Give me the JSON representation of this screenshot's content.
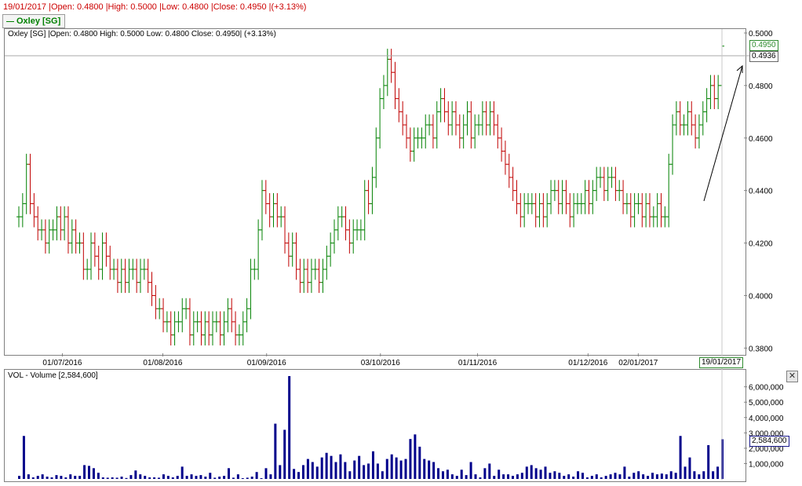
{
  "info_bar": {
    "text": "19/01/2017 |Open: 0.4800 |High: 0.5000 |Low: 0.4800 |Close: 0.4950 |(+3.13%)"
  },
  "legend": {
    "label": "Oxley [SG]",
    "color": "#008000"
  },
  "price_panel": {
    "header": "Oxley [SG] |Open: 0.4800   High: 0.5000   Low: 0.4800   Close: 0.4950| (+3.13%)",
    "close_badge": "0.4950",
    "crosshair_badge": "0.4936",
    "cursor_date_badge": "19/01/2017"
  },
  "volume_panel": {
    "header": "VOL - Volume [2,584,600]",
    "value_badge": "2,584,600",
    "close_icon": "close-icon"
  },
  "colors": {
    "up": "#008000",
    "down": "#c00000",
    "volume": "#00008b",
    "crosshair": "#a0a0a0"
  },
  "chart_data": [
    {
      "type": "ohlc",
      "title": "Oxley [SG]",
      "x_tick_labels": [
        "01/07/2016",
        "01/08/2016",
        "01/09/2016",
        "03/10/2016",
        "01/11/2016",
        "01/12/2016",
        "02/01/2017"
      ],
      "y_tick_labels": [
        "0.3800",
        "0.4000",
        "0.4200",
        "0.4400",
        "0.4600",
        "0.4800",
        "0.5000"
      ],
      "ylim": [
        0.378,
        0.5015
      ],
      "grid": false,
      "series": [
        {
          "name": "Oxley [SG]",
          "close": [
            0.43,
            0.435,
            0.45,
            0.435,
            0.43,
            0.425,
            0.425,
            0.42,
            0.425,
            0.425,
            0.43,
            0.425,
            0.43,
            0.42,
            0.425,
            0.42,
            0.42,
            0.41,
            0.41,
            0.42,
            0.415,
            0.41,
            0.42,
            0.415,
            0.41,
            0.41,
            0.405,
            0.41,
            0.405,
            0.41,
            0.41,
            0.405,
            0.41,
            0.41,
            0.405,
            0.4,
            0.395,
            0.395,
            0.39,
            0.39,
            0.385,
            0.39,
            0.39,
            0.395,
            0.395,
            0.385,
            0.39,
            0.39,
            0.385,
            0.39,
            0.385,
            0.39,
            0.39,
            0.385,
            0.39,
            0.395,
            0.39,
            0.385,
            0.385,
            0.39,
            0.395,
            0.41,
            0.41,
            0.425,
            0.44,
            0.435,
            0.43,
            0.435,
            0.43,
            0.43,
            0.42,
            0.415,
            0.42,
            0.41,
            0.405,
            0.41,
            0.405,
            0.41,
            0.41,
            0.405,
            0.41,
            0.415,
            0.42,
            0.425,
            0.43,
            0.43,
            0.425,
            0.42,
            0.425,
            0.425,
            0.425,
            0.44,
            0.435,
            0.445,
            0.46,
            0.475,
            0.48,
            0.49,
            0.485,
            0.475,
            0.47,
            0.465,
            0.46,
            0.455,
            0.46,
            0.46,
            0.46,
            0.465,
            0.465,
            0.46,
            0.47,
            0.475,
            0.47,
            0.465,
            0.47,
            0.465,
            0.46,
            0.465,
            0.47,
            0.46,
            0.465,
            0.465,
            0.47,
            0.465,
            0.47,
            0.465,
            0.46,
            0.455,
            0.45,
            0.445,
            0.44,
            0.435,
            0.43,
            0.435,
            0.435,
            0.435,
            0.43,
            0.435,
            0.43,
            0.435,
            0.44,
            0.44,
            0.435,
            0.44,
            0.435,
            0.43,
            0.435,
            0.435,
            0.435,
            0.44,
            0.435,
            0.44,
            0.445,
            0.445,
            0.44,
            0.445,
            0.445,
            0.44,
            0.44,
            0.435,
            0.435,
            0.43,
            0.435,
            0.435,
            0.43,
            0.435,
            0.43,
            0.43,
            0.435,
            0.43,
            0.43,
            0.45,
            0.465,
            0.47,
            0.465,
            0.465,
            0.47,
            0.465,
            0.46,
            0.465,
            0.47,
            0.475,
            0.48,
            0.475,
            0.48,
            0.495
          ],
          "color_up": "#008000",
          "color_down": "#c00000"
        }
      ]
    },
    {
      "type": "bar",
      "title": "VOL - Volume [2,584,600]",
      "y_tick_labels": [
        "1,000,000",
        "2,000,000",
        "3,000,000",
        "4,000,000",
        "5,000,000",
        "6,000,000"
      ],
      "ylim": [
        0,
        6700000
      ],
      "grid": false,
      "series": [
        {
          "name": "VOL - Volume",
          "values": [
            200000,
            2800000,
            300000,
            100000,
            200000,
            300000,
            150000,
            100000,
            250000,
            200000,
            100000,
            300000,
            200000,
            200000,
            900000,
            850000,
            700000,
            400000,
            100000,
            80000,
            100000,
            80000,
            150000,
            60000,
            250000,
            550000,
            300000,
            200000,
            100000,
            100000,
            80000,
            300000,
            200000,
            100000,
            200000,
            800000,
            200000,
            300000,
            200000,
            250000,
            150000,
            400000,
            80000,
            150000,
            200000,
            700000,
            80000,
            300000,
            50000,
            80000,
            150000,
            450000,
            50000,
            700000,
            300000,
            3600000,
            900000,
            3200000,
            6700000,
            650000,
            450000,
            900000,
            1300000,
            1100000,
            800000,
            1400000,
            1700000,
            1500000,
            1100000,
            1600000,
            1100000,
            500000,
            1200000,
            1500000,
            900000,
            1000000,
            1800000,
            1000000,
            500000,
            1300000,
            1600000,
            1400000,
            1200000,
            1300000,
            2600000,
            2900000,
            2100000,
            1300000,
            1200000,
            1100000,
            700000,
            500000,
            600000,
            300000,
            200000,
            600000,
            250000,
            1100000,
            300000,
            100000,
            700000,
            1000000,
            200000,
            600000,
            300000,
            300000,
            200000,
            300000,
            400000,
            800000,
            900000,
            700000,
            600000,
            800000,
            400000,
            500000,
            400000,
            200000,
            300000,
            150000,
            500000,
            400000,
            100000,
            200000,
            300000,
            100000,
            200000,
            300000,
            400000,
            300000,
            800000,
            150000,
            400000,
            500000,
            300000,
            200000,
            400000,
            300000,
            350000,
            300000,
            500000,
            400000,
            2800000,
            800000,
            1400000,
            500000,
            300000,
            500000,
            2200000,
            500000,
            800000,
            2584600
          ]
        }
      ]
    }
  ]
}
